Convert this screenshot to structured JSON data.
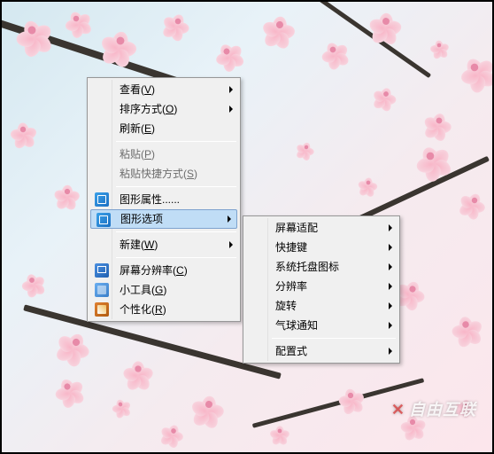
{
  "desktop": {
    "watermark": "自由互联"
  },
  "contextMenu": {
    "items": [
      {
        "label": "查看",
        "shortcut": "V",
        "submenu": true
      },
      {
        "label": "排序方式",
        "shortcut": "O",
        "submenu": true
      },
      {
        "label": "刷新",
        "shortcut": "E"
      },
      {
        "sep": true
      },
      {
        "label": "粘贴",
        "shortcut": "P",
        "disabled": true
      },
      {
        "label": "粘贴快捷方式",
        "shortcut": "S",
        "disabled": true
      },
      {
        "sep": true
      },
      {
        "label": "图形属性......",
        "icon": "gfx"
      },
      {
        "label": "图形选项",
        "icon": "gfx",
        "submenu": true,
        "highlighted": true
      },
      {
        "sep": true
      },
      {
        "label": "新建",
        "shortcut": "W",
        "submenu": true
      },
      {
        "sep": true
      },
      {
        "label": "屏幕分辨率",
        "shortcut": "C",
        "icon": "res"
      },
      {
        "label": "小工具",
        "shortcut": "G",
        "icon": "gadget"
      },
      {
        "label": "个性化",
        "shortcut": "R",
        "icon": "pers"
      }
    ]
  },
  "submenu": {
    "items": [
      {
        "label": "屏幕适配",
        "submenu": true
      },
      {
        "label": "快捷键",
        "submenu": true
      },
      {
        "label": "系统托盘图标",
        "submenu": true
      },
      {
        "label": "分辨率",
        "submenu": true
      },
      {
        "label": "旋转",
        "submenu": true
      },
      {
        "label": "气球通知",
        "submenu": true
      },
      {
        "sep": true
      },
      {
        "label": "配置式",
        "submenu": true
      }
    ]
  }
}
